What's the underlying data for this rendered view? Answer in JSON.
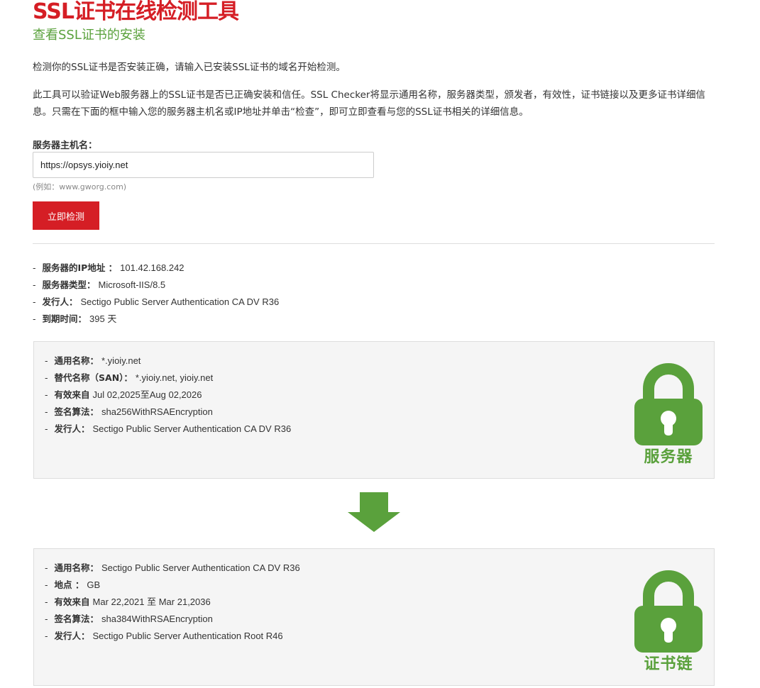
{
  "header": {
    "title": "SSL证书在线检测工具",
    "subtitle": "查看SSL证书的安装"
  },
  "intro": {
    "line1": "检测你的SSL证书是否安装正确，请输入已安装SSL证书的域名开始检测。",
    "line2": "此工具可以验证Web服务器上的SSL证书是否已正确安装和信任。SSL Checker将显示通用名称，服务器类型，颁发者，有效性，证书链接以及更多证书详细信息。只需在下面的框中输入您的服务器主机名或IP地址并单击“检查”，即可立即查看与您的SSL证书相关的详细信息。"
  },
  "form": {
    "host_label": "服务器主机名：",
    "host_value": "https://opsys.yioiy.net",
    "host_hint": "(例如：www.gworg.com)",
    "submit_label": "立即检测"
  },
  "server_info": [
    {
      "label": "服务器的IP地址 ：",
      "value": "101.42.168.242"
    },
    {
      "label": "服务器类型：",
      "value": "Microsoft-IIS/8.5"
    },
    {
      "label": "发行人：",
      "value": "Sectigo Public Server Authentication CA DV R36"
    },
    {
      "label": "到期时间：",
      "value": "395 天"
    }
  ],
  "server_cert": {
    "caption": "服务器",
    "icon": "lock-icon",
    "rows": [
      {
        "label": "通用名称：",
        "value": "*.yioiy.net"
      },
      {
        "label": "替代名称（SAN）：",
        "value": "*.yioiy.net, yioiy.net"
      },
      {
        "label": "有效来自",
        "value": "Jul 02,2025至Aug 02,2026"
      },
      {
        "label": "签名算法：",
        "value": "sha256WithRSAEncryption"
      },
      {
        "label": "发行人：",
        "value": "Sectigo Public Server Authentication CA DV R36"
      }
    ]
  },
  "chain_cert": {
    "caption": "证书链",
    "icon": "lock-icon",
    "rows": [
      {
        "label": "通用名称：",
        "value": "Sectigo Public Server Authentication CA DV R36"
      },
      {
        "label": "地点 ：",
        "value": "GB"
      },
      {
        "label": "有效来自",
        "value": "Mar 22,2021 至 Mar 21,2036"
      },
      {
        "label": "签名算法：",
        "value": "sha384WithRSAEncryption"
      },
      {
        "label": "发行人：",
        "value": "Sectigo Public Server Authentication Root R46"
      }
    ]
  },
  "colors": {
    "brand_red": "#d51e25",
    "accent_green": "#5aa13c",
    "box_bg": "#f5f5f5"
  },
  "icons": {
    "arrow": "arrow-down-icon",
    "list_marker": "-"
  }
}
